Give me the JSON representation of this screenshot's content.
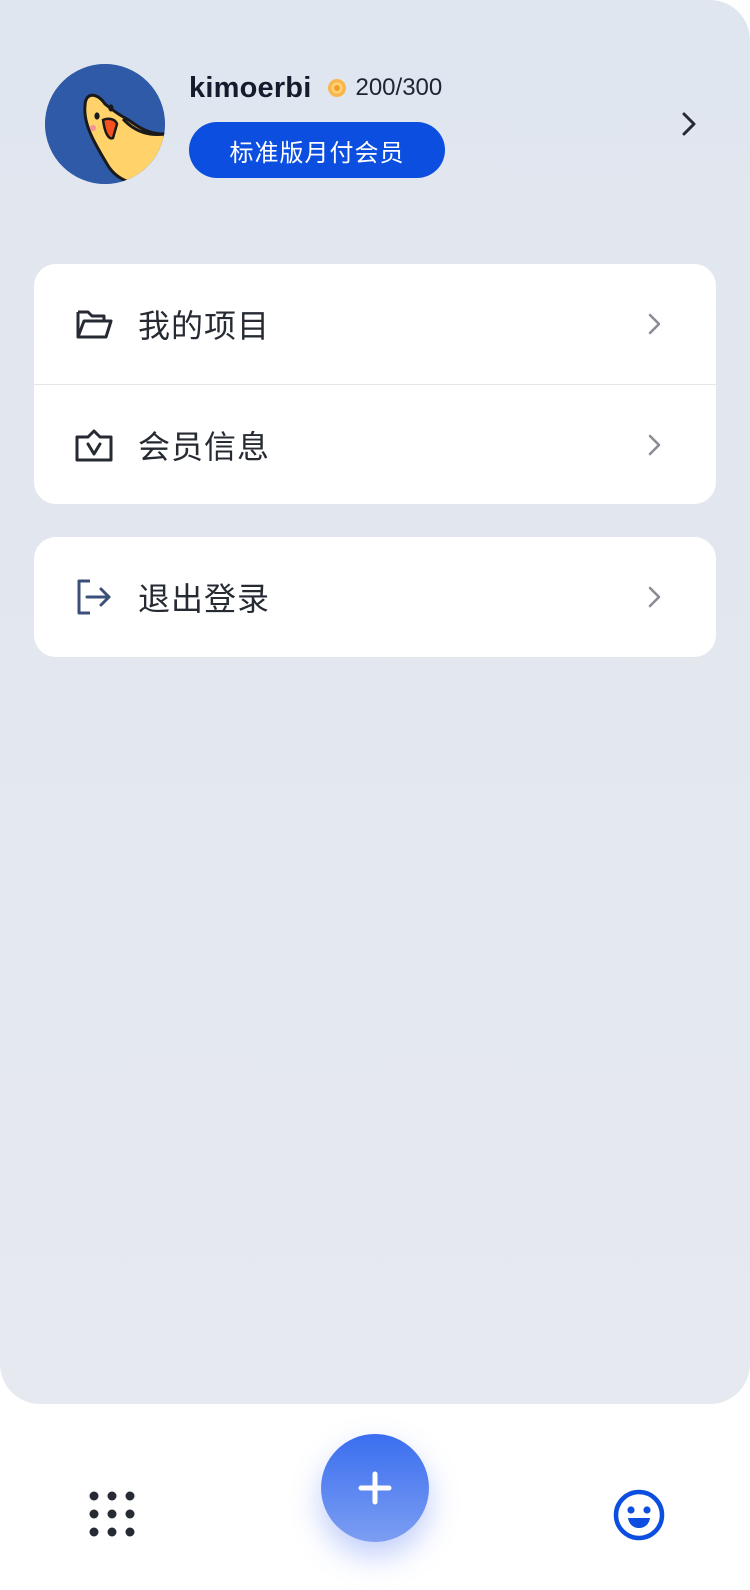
{
  "profile": {
    "username": "kimoerbi",
    "points": "200/300",
    "membership_label": "标准版月付会员"
  },
  "menu": {
    "projects_label": "我的项目",
    "membership_info_label": "会员信息",
    "logout_label": "退出登录"
  },
  "bottom_nav": {
    "left_icon": "apps-grid-icon",
    "center_icon": "plus-icon",
    "right_icon": "smiley-profile-icon"
  },
  "colors": {
    "accent": "#0b4ee0",
    "background": "#e2e7ef",
    "coin": "#f5a623"
  }
}
